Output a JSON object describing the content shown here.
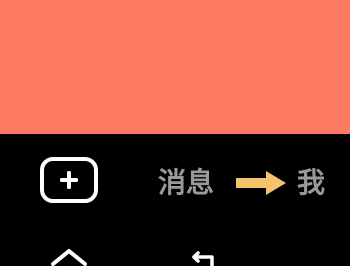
{
  "content": {
    "background_color": "#FF7A63"
  },
  "tab_bar": {
    "create_button": {
      "icon": "plus-square-icon"
    },
    "messages_label": "消息",
    "annotation_arrow": {
      "icon": "arrow-right-icon",
      "color": "#F5C36B"
    },
    "me_label": "我",
    "inactive_label_color": "#9a9a9a"
  },
  "system_nav": {
    "home": {
      "icon": "home-icon"
    },
    "back": {
      "icon": "back-icon"
    }
  }
}
